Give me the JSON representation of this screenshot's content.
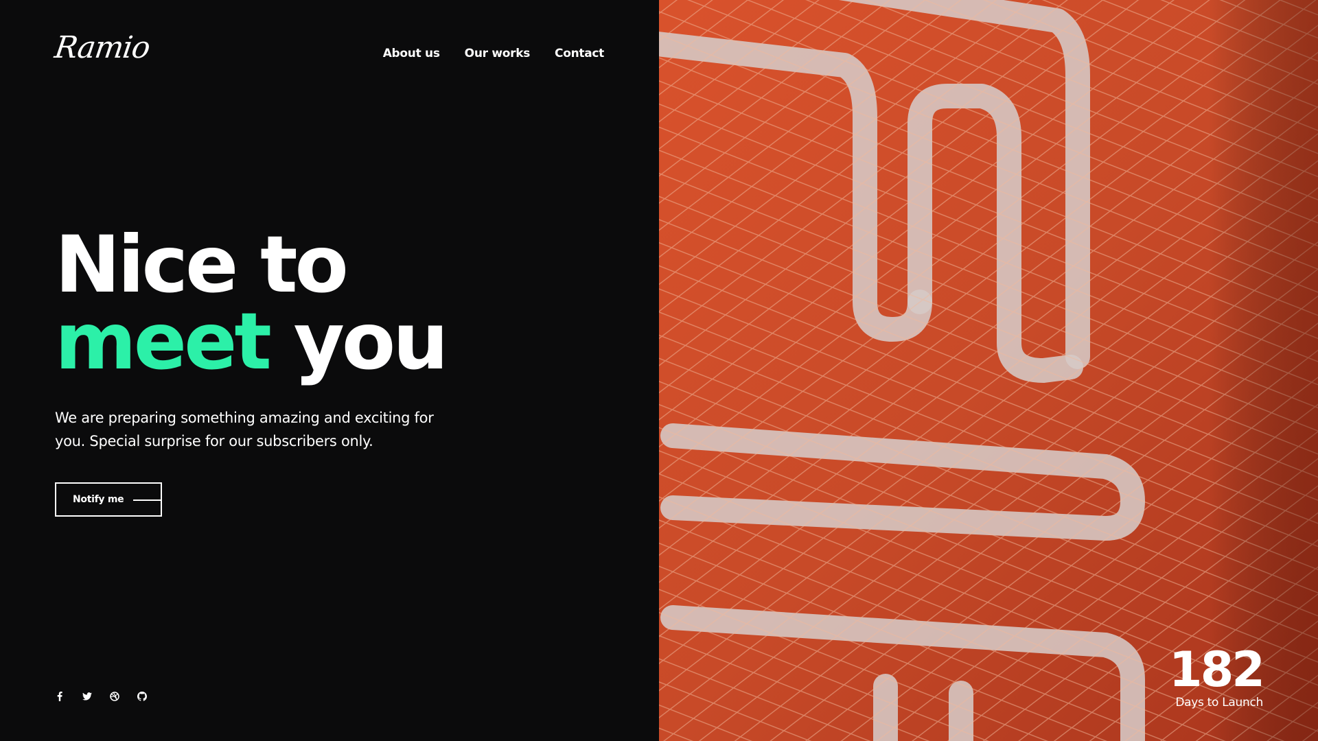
{
  "brand": {
    "logo_text": "Ramio"
  },
  "nav": {
    "items": [
      {
        "label": "About us"
      },
      {
        "label": "Our works"
      },
      {
        "label": "Contact"
      }
    ]
  },
  "hero": {
    "headline_line1": "Nice to",
    "headline_accent": "meet",
    "headline_rest": "you",
    "subtitle": "We are preparing something amazing and exciting for you. Special surprise for our subscribers only.",
    "cta_label": "Notify me"
  },
  "social": {
    "icons": [
      "facebook-icon",
      "twitter-icon",
      "dribbble-icon",
      "github-icon"
    ]
  },
  "countdown": {
    "value": "182",
    "label": "Days to Launch"
  },
  "colors": {
    "background": "#0b0b0c",
    "accent": "#2cf0a8",
    "image_tint": "#c84a28",
    "text": "#ffffff"
  }
}
